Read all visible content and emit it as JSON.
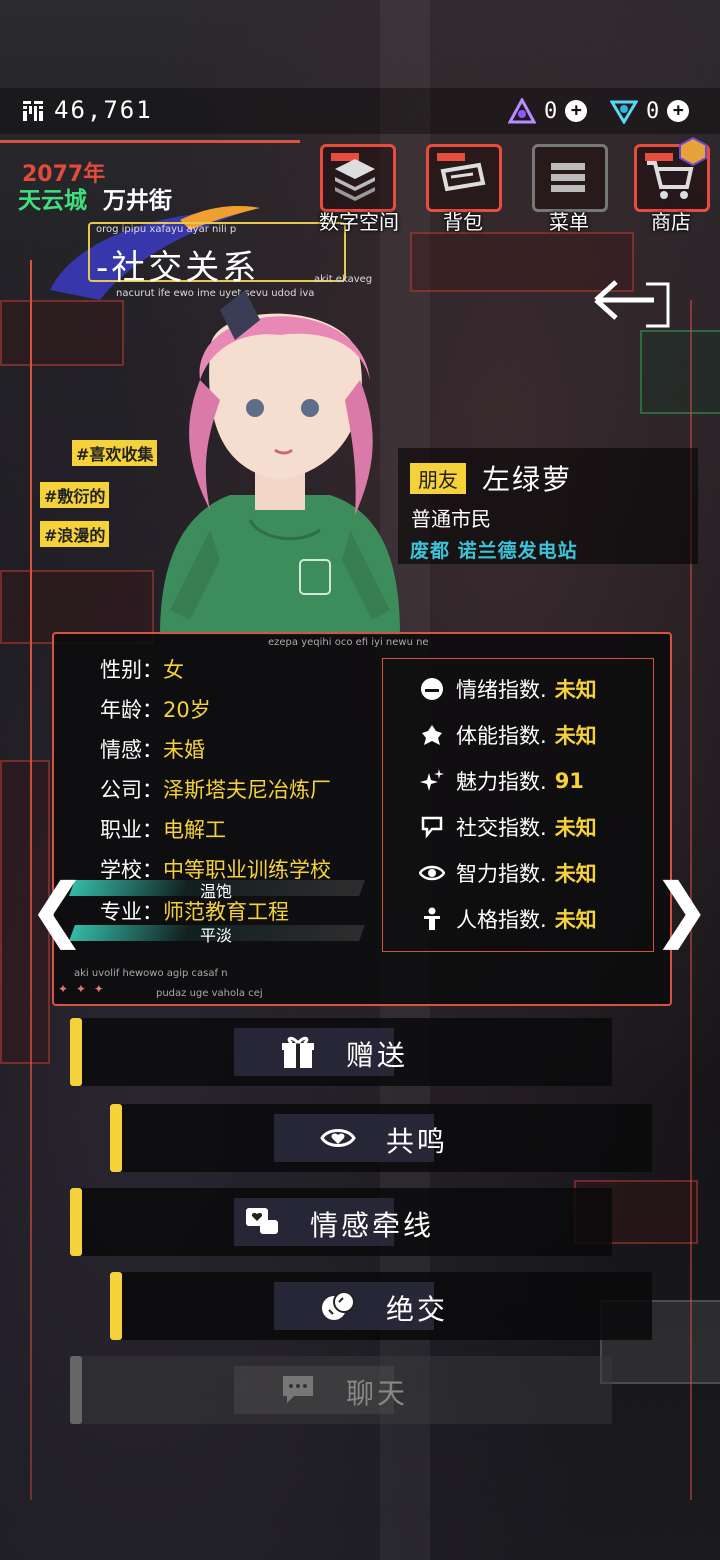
{
  "currency": {
    "coins": "46,761",
    "gem_a": "0",
    "gem_b": "0"
  },
  "header": {
    "year": "2077年",
    "district": "天云城",
    "street": "万井街"
  },
  "page_title": {
    "title": "-社交关系",
    "tiny_top": "orog ipipu xafayu ayar nili p",
    "tiny_bottom": "nacurut ife ewo ime uyet sevu udod iva",
    "tiny_right": "akit ekaveg"
  },
  "nav": [
    {
      "label": "数字空间",
      "icon": "layers-icon"
    },
    {
      "label": "背包",
      "icon": "bag-icon"
    },
    {
      "label": "菜单",
      "icon": "menu-icon"
    },
    {
      "label": "商店",
      "icon": "cart-icon"
    }
  ],
  "tags": [
    "#喜欢收集",
    "#敷衍的",
    "#浪漫的"
  ],
  "character": {
    "relation": "朋友",
    "name": "左绿萝",
    "occupation": "普通市民",
    "location": "废都 诺兰德发电站"
  },
  "info_tiny": {
    "top": "ezepa yeqihi oco efi iyi newu ne",
    "bottom1": "aki uvolif hewowo agip casaf n",
    "bottom2": "pudaz uge vahola cej"
  },
  "profile": [
    {
      "key": "性别：",
      "value": "女"
    },
    {
      "key": "年龄：",
      "value": "20岁"
    },
    {
      "key": "情感：",
      "value": "未婚"
    },
    {
      "key": "公司：",
      "value": "泽斯塔夫尼冶炼厂"
    },
    {
      "key": "职业：",
      "value": "电解工"
    },
    {
      "key": "学校：",
      "value": "中等职业训练学校"
    },
    {
      "key": "专业：",
      "value": "师范教育工程"
    }
  ],
  "overlay_labels": {
    "a": "温饱",
    "b": "平淡"
  },
  "stats": [
    {
      "label": "情绪指数.",
      "value": "未知",
      "icon": "mood-icon"
    },
    {
      "label": "体能指数.",
      "value": "未知",
      "icon": "stamina-icon"
    },
    {
      "label": "魅力指数.",
      "value": "91",
      "icon": "sparkle-icon"
    },
    {
      "label": "社交指数.",
      "value": "未知",
      "icon": "social-icon"
    },
    {
      "label": "智力指数.",
      "value": "未知",
      "icon": "eye-icon"
    },
    {
      "label": "人格指数.",
      "value": "未知",
      "icon": "person-icon"
    }
  ],
  "actions": [
    {
      "label": "赠送",
      "icon": "gift-icon"
    },
    {
      "label": "共鸣",
      "icon": "resonate-icon"
    },
    {
      "label": "情感牵线",
      "icon": "chat-heart-icon"
    },
    {
      "label": "绝交",
      "icon": "break-icon"
    },
    {
      "label": "聊天",
      "icon": "chat-icon"
    }
  ],
  "colors": {
    "accent": "#d8533f",
    "highlight": "#f5d23a",
    "location": "#3cc3d8",
    "district": "#3ee07d"
  }
}
